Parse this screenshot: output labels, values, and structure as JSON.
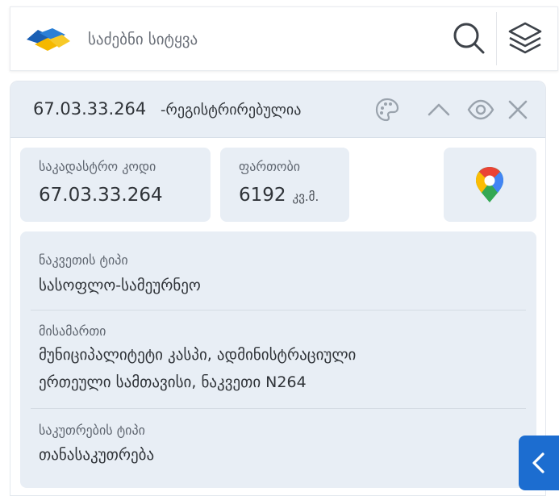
{
  "search": {
    "placeholder": "საძებნი სიტყვა",
    "logo_icon": "brand-logo-icon",
    "search_icon": "search-icon",
    "layers_icon": "layers-icon"
  },
  "parcel": {
    "code": "67.03.33.264",
    "status": "-რეგისტრირებულია",
    "header_icons": [
      "palette-icon",
      "chevron-up-icon",
      "eye-icon",
      "close-icon"
    ]
  },
  "cards": {
    "cadastral_label": "საკადასტრო კოდი",
    "cadastral_value": "67.03.33.264",
    "area_label": "ფართობი",
    "area_value": "6192",
    "area_unit": "კვ.მ.",
    "maps_icon": "google-maps-icon"
  },
  "details": {
    "parcel_type_label": "ნაკვეთის ტიპი",
    "parcel_type_value": "სასოფლო-სამეურნეო",
    "address_label": "მისამართი",
    "address_line1": "მუნიციპალიტეტი კასპი, ადმინისტრაციული",
    "address_line2": "ერთეული სამთავისი, ნაკვეთი N264",
    "ownership_label": "საკუთრების ტიპი",
    "ownership_value": "თანასაკუთრება"
  },
  "side_toggle_icon": "chevron-left-icon",
  "colors": {
    "accent": "#1c6dd0",
    "panel_bg": "#e8eef5",
    "text": "#2f3338",
    "muted_text": "#5f6670"
  }
}
